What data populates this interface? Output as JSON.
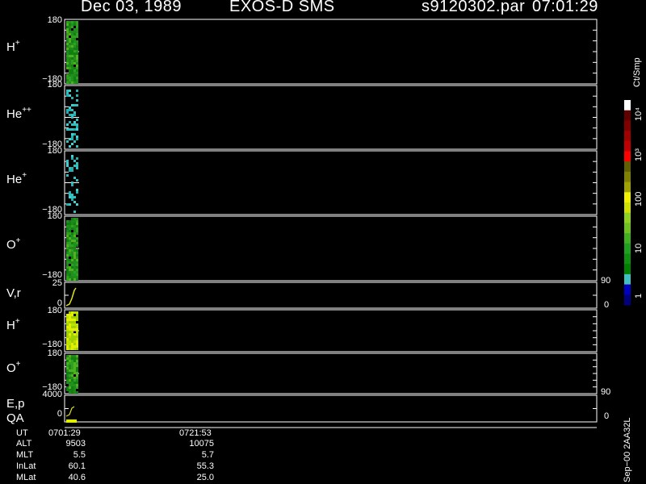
{
  "header": {
    "date": "Dec 03, 1989",
    "mission": "EXOS-D SMS",
    "file": "s9120302.par",
    "time": "07:01:29"
  },
  "panels": [
    {
      "species": "H",
      "charge": "+",
      "ymax": "180",
      "ymin": "−180"
    },
    {
      "species": "He",
      "charge": "++",
      "ymax": "180",
      "ymin": "−180"
    },
    {
      "species": "He",
      "charge": "+",
      "ymax": "180",
      "ymin": "−180"
    },
    {
      "species": "O",
      "charge": "+",
      "ymax": "180",
      "ymin": "−180"
    },
    {
      "species": "V,r",
      "charge": "",
      "ymax": "25",
      "ymin": "0",
      "rtop": "90",
      "rbottom": "0"
    },
    {
      "species": "H",
      "charge": "+",
      "ymax": "180",
      "ymin": "−180"
    },
    {
      "species": "O",
      "charge": "+",
      "ymax": "180",
      "ymin": "−180"
    },
    {
      "species": "E,p",
      "charge": "",
      "ymax": "4000",
      "ymin": "0",
      "rtop": "90",
      "rbottom": "0"
    }
  ],
  "qa_label": "QA",
  "colorbar": {
    "unit": "Ct/Smp",
    "ticks": [
      "10⁴",
      "10³",
      "100",
      "10",
      "1"
    ],
    "colors": [
      "#000080",
      "#0000c0",
      "#40c0c0",
      "#008000",
      "#109010",
      "#20a020",
      "#40b020",
      "#70c020",
      "#90d020",
      "#d0e000",
      "#f0f000",
      "#a0a000",
      "#808000",
      "#606000",
      "#ff0000",
      "#c00000",
      "#a00000",
      "#800000",
      "#600000",
      "#ffffff"
    ]
  },
  "footer": {
    "rows": [
      {
        "label": "UT",
        "v1": "0701:29",
        "v2": "0721:53"
      },
      {
        "label": "ALT",
        "v1": "9503",
        "v2": "10075"
      },
      {
        "label": "MLT",
        "v1": "5.5",
        "v2": "5.7"
      },
      {
        "label": "InLat",
        "v1": "60.1",
        "v2": "55.3"
      },
      {
        "label": "MLat",
        "v1": "40.6",
        "v2": "25.0"
      }
    ],
    "version": "Sep−00  2AA32L"
  },
  "chart_data": {
    "type": "heatmap",
    "title": "Dec 03, 1989   EXOS-D SMS   s9120302.par  07:01:29",
    "x_ticks": [
      "0701:29",
      "0721:53"
    ],
    "panels": [
      "H+",
      "He++",
      "He+",
      "O+",
      "V,r",
      "H+",
      "O+",
      "E,p"
    ],
    "y_range_pitch": [
      -180,
      180
    ],
    "vr_range": [
      0,
      25
    ],
    "ep_range": [
      0,
      4000
    ],
    "color_scale": "log",
    "color_range": [
      1,
      10000
    ],
    "color_unit": "Ct/Smp"
  }
}
